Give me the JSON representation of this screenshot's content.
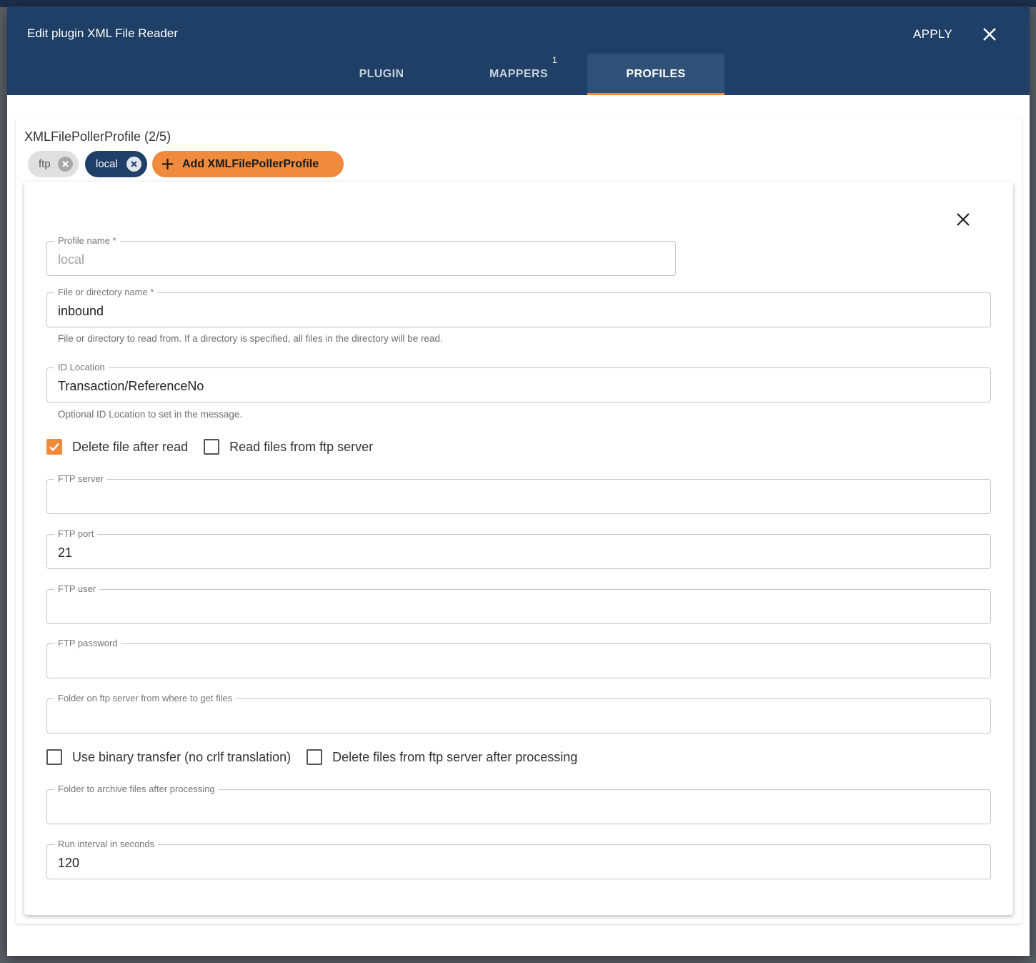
{
  "dialog": {
    "title": "Edit plugin XML File Reader",
    "apply_label": "APPLY"
  },
  "tabs": [
    {
      "label": "PLUGIN",
      "badge": ""
    },
    {
      "label": "MAPPERS",
      "badge": "1"
    },
    {
      "label": "PROFILES",
      "badge": "",
      "active": true
    }
  ],
  "profiles": {
    "heading": "XMLFilePollerProfile (2/5)",
    "chips": [
      {
        "label": "ftp",
        "selected": false
      },
      {
        "label": "local",
        "selected": true
      }
    ],
    "add_label": "Add XMLFilePollerProfile"
  },
  "form": {
    "profile_name": {
      "label": "Profile name *",
      "value": "local"
    },
    "file_or_directory": {
      "label": "File or directory name *",
      "value": "inbound",
      "helper": "File or directory to read from. If a directory is specified, all files in the directory will be read."
    },
    "id_location": {
      "label": "ID Location",
      "value": "Transaction/ReferenceNo",
      "helper": "Optional ID Location to set in the message."
    },
    "delete_after_read": {
      "label": "Delete file after read",
      "checked": true
    },
    "read_from_ftp": {
      "label": "Read files from ftp server",
      "checked": false
    },
    "ftp_server": {
      "label": "FTP server",
      "value": ""
    },
    "ftp_port": {
      "label": "FTP port",
      "value": "21"
    },
    "ftp_user": {
      "label": "FTP user",
      "value": ""
    },
    "ftp_password": {
      "label": "FTP password",
      "value": ""
    },
    "ftp_folder": {
      "label": "Folder on ftp server from where to get files",
      "value": ""
    },
    "binary_transfer": {
      "label": "Use binary transfer (no crlf translation)",
      "checked": false
    },
    "delete_from_ftp": {
      "label": "Delete files from ftp server after processing",
      "checked": false
    },
    "archive_folder": {
      "label": "Folder to archive files after processing",
      "value": ""
    },
    "run_interval": {
      "label": "Run interval in seconds",
      "value": "120"
    }
  },
  "colors": {
    "header": "#1f3f66",
    "active_tab": "#2f5178",
    "accent": "#f08a3c"
  }
}
